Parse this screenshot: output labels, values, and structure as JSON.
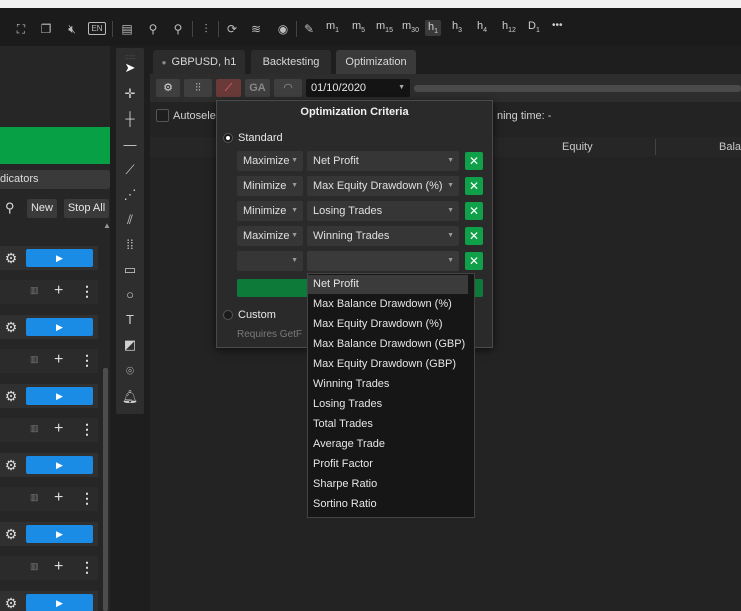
{
  "toolbar": {
    "left_icons": [
      "expand-icon",
      "window-icon",
      "mute-icon",
      "language-badge"
    ],
    "language_label": "EN",
    "icons": [
      "layout-icon",
      "zoom-in-icon",
      "zoom-out-icon",
      "chart-type-icon",
      "sync-icon",
      "layers-icon",
      "eye-icon",
      "drawing-tools-icon"
    ],
    "timeframes": [
      {
        "base": "m",
        "sub": "1"
      },
      {
        "base": "m",
        "sub": "5"
      },
      {
        "base": "m",
        "sub": "15"
      },
      {
        "base": "m",
        "sub": "30"
      },
      {
        "base": "h",
        "sub": "1"
      },
      {
        "base": "h",
        "sub": "3"
      },
      {
        "base": "h",
        "sub": "4"
      },
      {
        "base": "h",
        "sub": "12"
      },
      {
        "base": "D",
        "sub": "1"
      }
    ],
    "more_label": "•••"
  },
  "left_panel": {
    "indicators_label": "dicators",
    "new_label": "New",
    "stop_all_label": "Stop All"
  },
  "tabs": [
    {
      "label": "GBPUSD, h1",
      "active": false
    },
    {
      "label": "Backtesting",
      "active": false
    },
    {
      "label": "Optimization",
      "active": true
    }
  ],
  "optimization_bar": {
    "ga_label": "GA",
    "date_value": "01/10/2020",
    "autoselect_label": "Autosele",
    "remaining_label": "ning time: -"
  },
  "results": {
    "columns": [
      "Equity",
      "Bala"
    ]
  },
  "popup": {
    "title": "Optimization Criteria",
    "standard_label": "Standard",
    "custom_label": "Custom",
    "requires_label": "Requires GetF",
    "criteria": [
      {
        "direction": "Maximize",
        "metric": "Net Profit"
      },
      {
        "direction": "Minimize",
        "metric": "Max Equity Drawdown (%)"
      },
      {
        "direction": "Minimize",
        "metric": "Losing Trades"
      },
      {
        "direction": "Maximize",
        "metric": "Winning Trades"
      },
      {
        "direction": "",
        "metric": ""
      }
    ]
  },
  "dropdown_options": [
    "Net Profit",
    "Max Balance Drawdown (%)",
    "Max Equity Drawdown (%)",
    "Max Balance Drawdown (GBP)",
    "Max Equity Drawdown (GBP)",
    "Winning Trades",
    "Losing Trades",
    "Total Trades",
    "Average Trade",
    "Profit Factor",
    "Sharpe Ratio",
    "Sortino Ratio"
  ],
  "colors": {
    "accent_green": "#08a045",
    "play_blue": "#1a8ce6",
    "background": "#1e1e1e"
  }
}
